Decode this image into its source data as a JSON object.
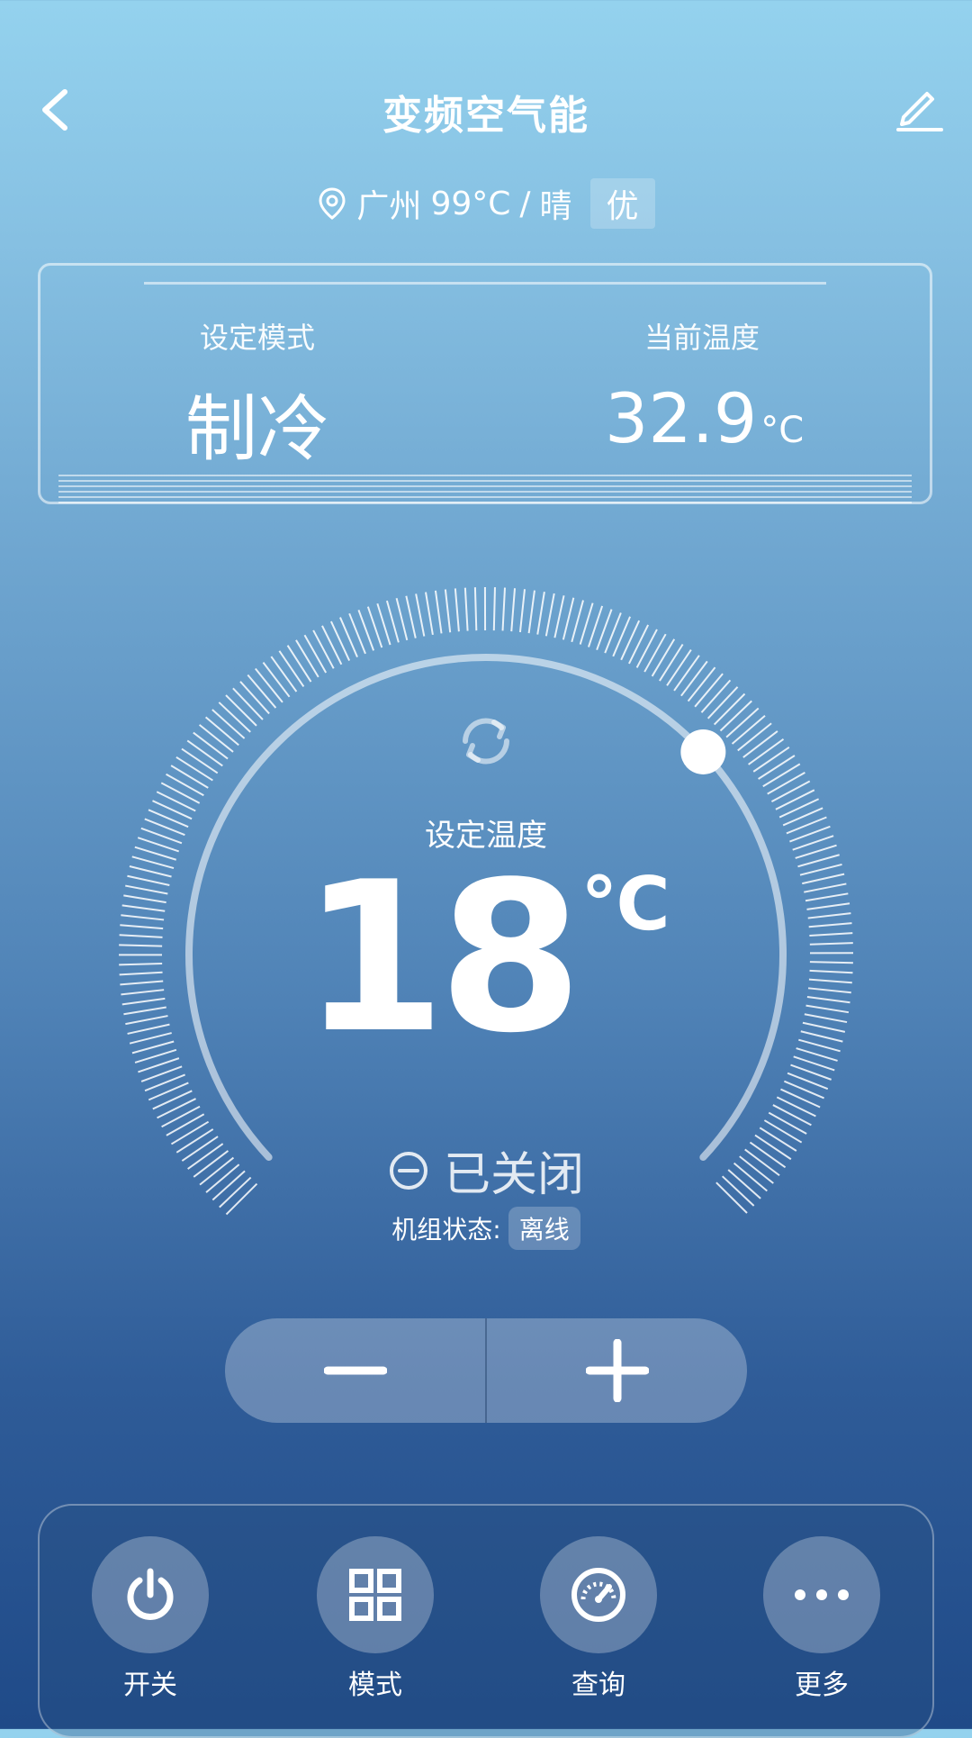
{
  "header": {
    "title": "变频空气能"
  },
  "weather": {
    "city": "广州",
    "temperature": "99°C",
    "separator": "/",
    "condition": "晴",
    "air_quality": "优"
  },
  "info_card": {
    "mode_label": "设定模式",
    "mode_value": "制冷",
    "current_temp_label": "当前温度",
    "current_temp_value": "32.9",
    "current_temp_unit": "°C"
  },
  "dial": {
    "set_temp_label": "设定温度",
    "set_temp_value": "18",
    "set_temp_unit": "℃",
    "power_status": "已关闭",
    "unit_status_label": "机组状态:",
    "unit_status_value": "离线"
  },
  "stepper": {
    "decrease": "−",
    "increase": "+"
  },
  "actions": [
    {
      "label": "开关",
      "icon": "power-icon"
    },
    {
      "label": "模式",
      "icon": "grid-icon"
    },
    {
      "label": "查询",
      "icon": "gauge-icon"
    },
    {
      "label": "更多",
      "icon": "more-icon"
    }
  ],
  "colors": {
    "background_top": "#94d2ee",
    "background_bottom": "#1f4a88",
    "foreground": "#ffffff"
  }
}
